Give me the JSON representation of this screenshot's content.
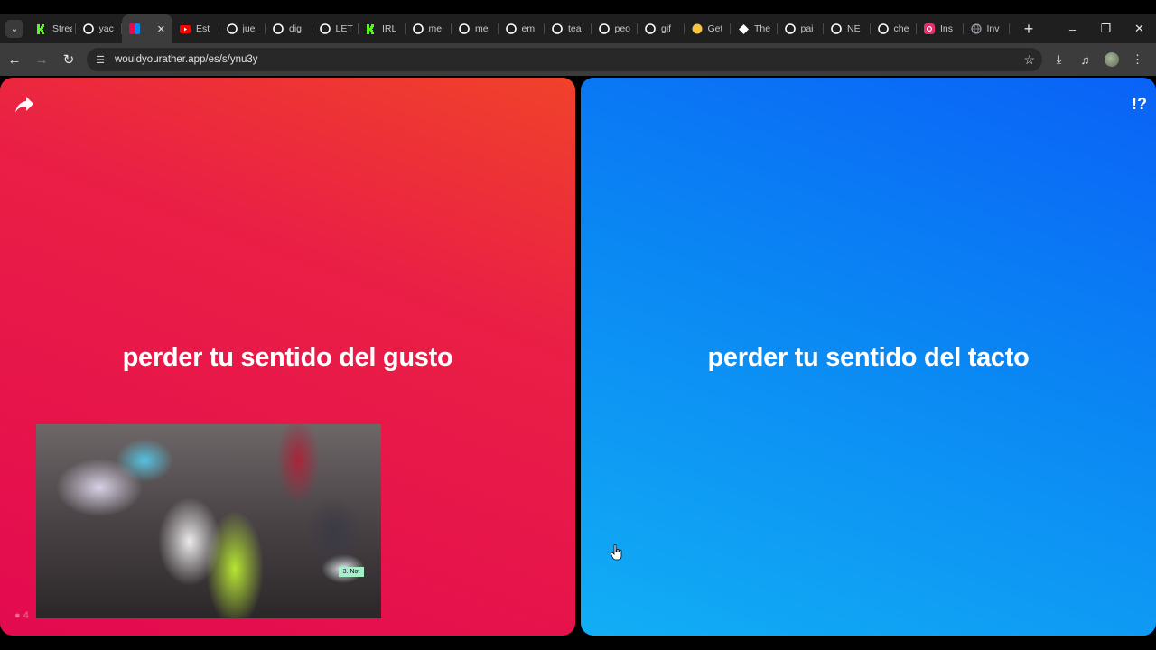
{
  "browser": {
    "tabs": [
      {
        "label": "Stream",
        "icon": "kick-icon",
        "color": "#53fc18"
      },
      {
        "label": "yac",
        "icon": "google-icon",
        "color": "#ffffff"
      },
      {
        "label": "",
        "icon": "wyr-icon",
        "color": "#e30a50",
        "active": true
      },
      {
        "label": "Est",
        "icon": "youtube-icon",
        "color": "#ff0000"
      },
      {
        "label": "jue",
        "icon": "google-icon",
        "color": "#ffffff"
      },
      {
        "label": "dig",
        "icon": "google-icon",
        "color": "#ffffff"
      },
      {
        "label": "LET",
        "icon": "google-icon",
        "color": "#ffffff"
      },
      {
        "label": "IRL",
        "icon": "kick-icon",
        "color": "#53fc18"
      },
      {
        "label": "me",
        "icon": "google-icon",
        "color": "#ffffff"
      },
      {
        "label": "me",
        "icon": "google-icon",
        "color": "#ffffff"
      },
      {
        "label": "em",
        "icon": "google-icon",
        "color": "#ffffff"
      },
      {
        "label": "tea",
        "icon": "google-icon",
        "color": "#ffffff"
      },
      {
        "label": "peo",
        "icon": "google-icon",
        "color": "#ffffff"
      },
      {
        "label": "gif",
        "icon": "google-icon",
        "color": "#ffffff"
      },
      {
        "label": "Get",
        "icon": "emoji-icon",
        "color": "#f6c343"
      },
      {
        "label": "The",
        "icon": "diamond-icon",
        "color": "#ffffff"
      },
      {
        "label": "pai",
        "icon": "google-icon",
        "color": "#ffffff"
      },
      {
        "label": "NE",
        "icon": "google-icon",
        "color": "#ffffff"
      },
      {
        "label": "che",
        "icon": "google-icon",
        "color": "#ffffff"
      },
      {
        "label": "Ins",
        "icon": "instagram-icon",
        "color": "#e1306c"
      },
      {
        "label": "Inv",
        "icon": "globe-icon",
        "color": "#9aa0a6"
      }
    ],
    "url": "wouldyourather.app/es/s/ynu3y"
  },
  "page": {
    "option_a": {
      "text": "perder tu sentido del gusto",
      "color": "#e30a50"
    },
    "option_b": {
      "text": "perder tu sentido del tacto",
      "color": "#0a86f3"
    },
    "flag_label": "!?",
    "webcam_sticker": "3. Not",
    "bottom_counter": "4"
  }
}
